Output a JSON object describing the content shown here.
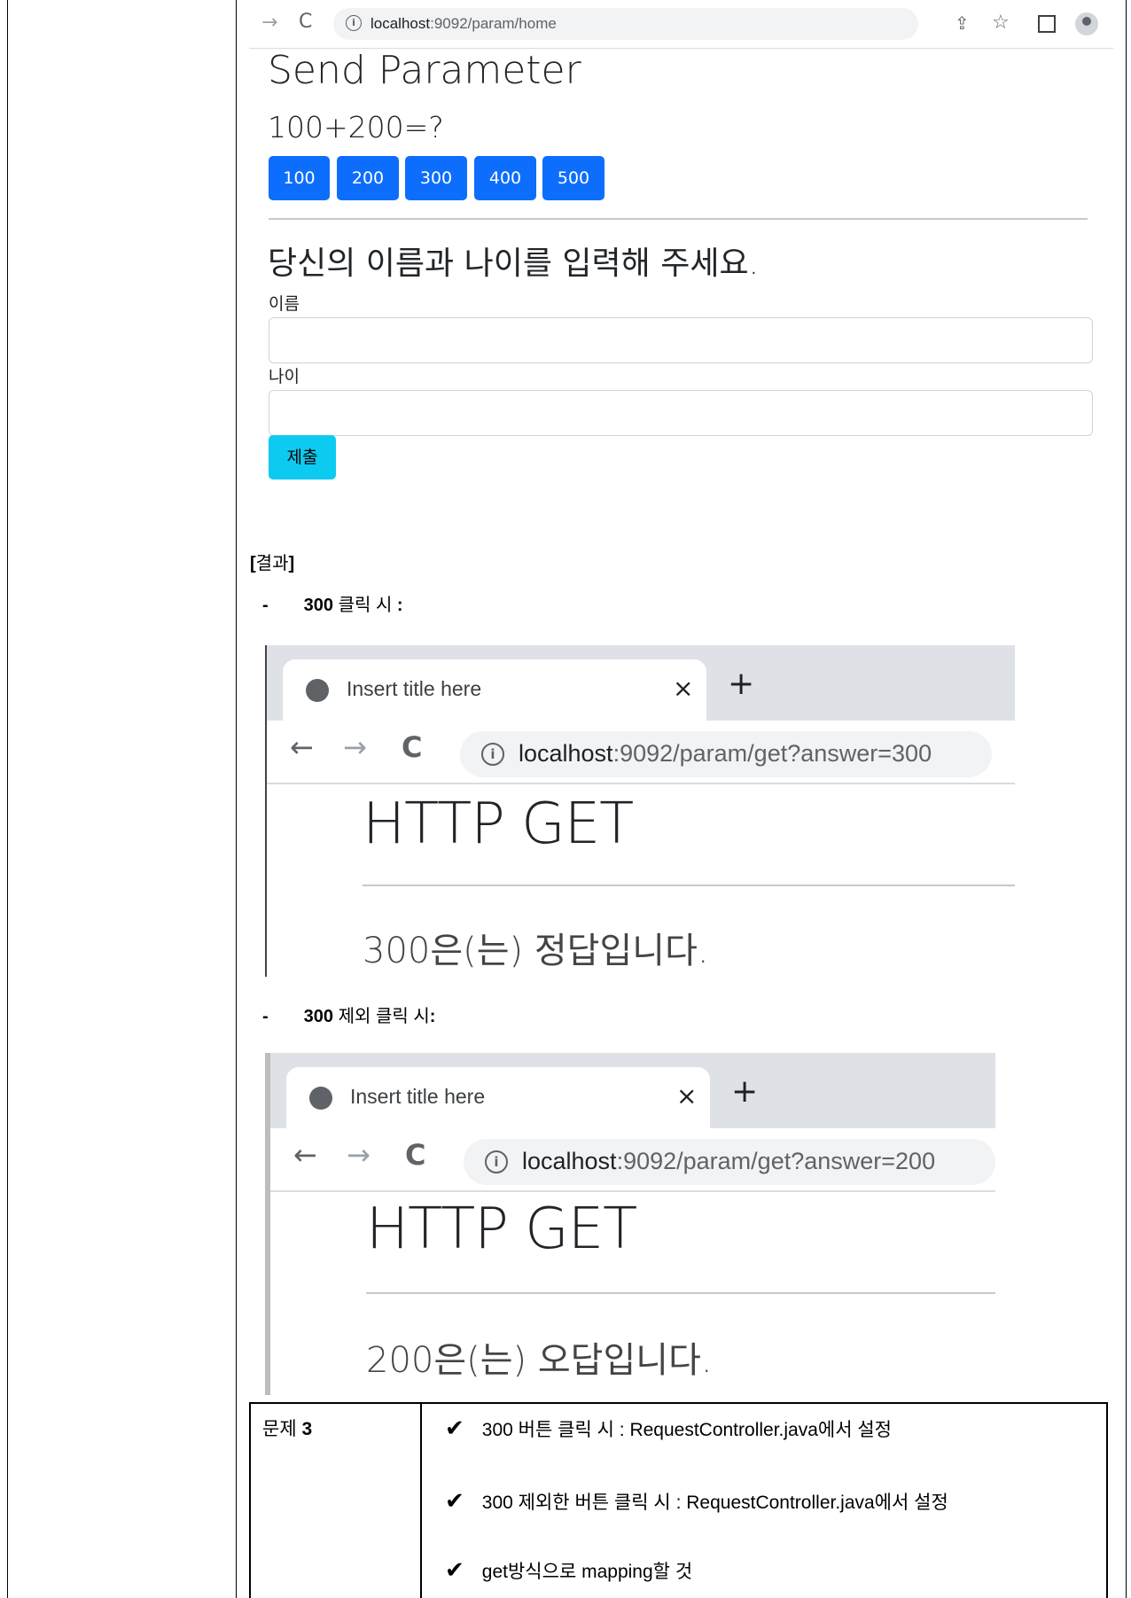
{
  "browser": {
    "url_host": "localhost",
    "url_rest": ":9092/param/home"
  },
  "page": {
    "title": "Send Parameter",
    "question": "100+200=?",
    "answer_buttons": [
      "100",
      "200",
      "300",
      "400",
      "500"
    ],
    "prompt": "당신의 이름과 나이를 입력해 주세요.",
    "name_label": "이름",
    "name_value": "",
    "age_label": "나이",
    "age_value": "",
    "submit_label": "제출"
  },
  "result": {
    "heading_open": "[",
    "heading_text": "결과",
    "heading_close": "]",
    "bullet": "-",
    "case1_bold": "300",
    "case1_text": " 클릭 시 ",
    "case1_colon": ":",
    "case2_bold": "300",
    "case2_text": " 제외 클릭 시",
    "case2_colon": ":"
  },
  "screenshot1": {
    "tab_title": "Insert title here",
    "close_glyph": "×",
    "newtab_glyph": "+",
    "url_host": "localhost",
    "url_rest": ":9092/param/get?answer=300",
    "heading": "HTTP GET",
    "message": "300은(는) 정답입니다."
  },
  "screenshot2": {
    "tab_title": "Insert title here",
    "close_glyph": "×",
    "newtab_glyph": "+",
    "url_host": "localhost",
    "url_rest": ":9092/param/get?answer=200",
    "heading": "HTTP GET",
    "message": "200은(는) 오답입니다."
  },
  "task_table": {
    "label_text": "문제 ",
    "label_number": "3",
    "check_glyph": "✔",
    "items": [
      "300 버튼 클릭 시 : RequestController.java에서 설정",
      "300 제외한 버튼 클릭 시 : RequestController.java에서 설정",
      "get방식으로 mapping할 것"
    ]
  },
  "colors": {
    "primary_button": "#0d6efd",
    "info_button": "#0dcaf0"
  }
}
